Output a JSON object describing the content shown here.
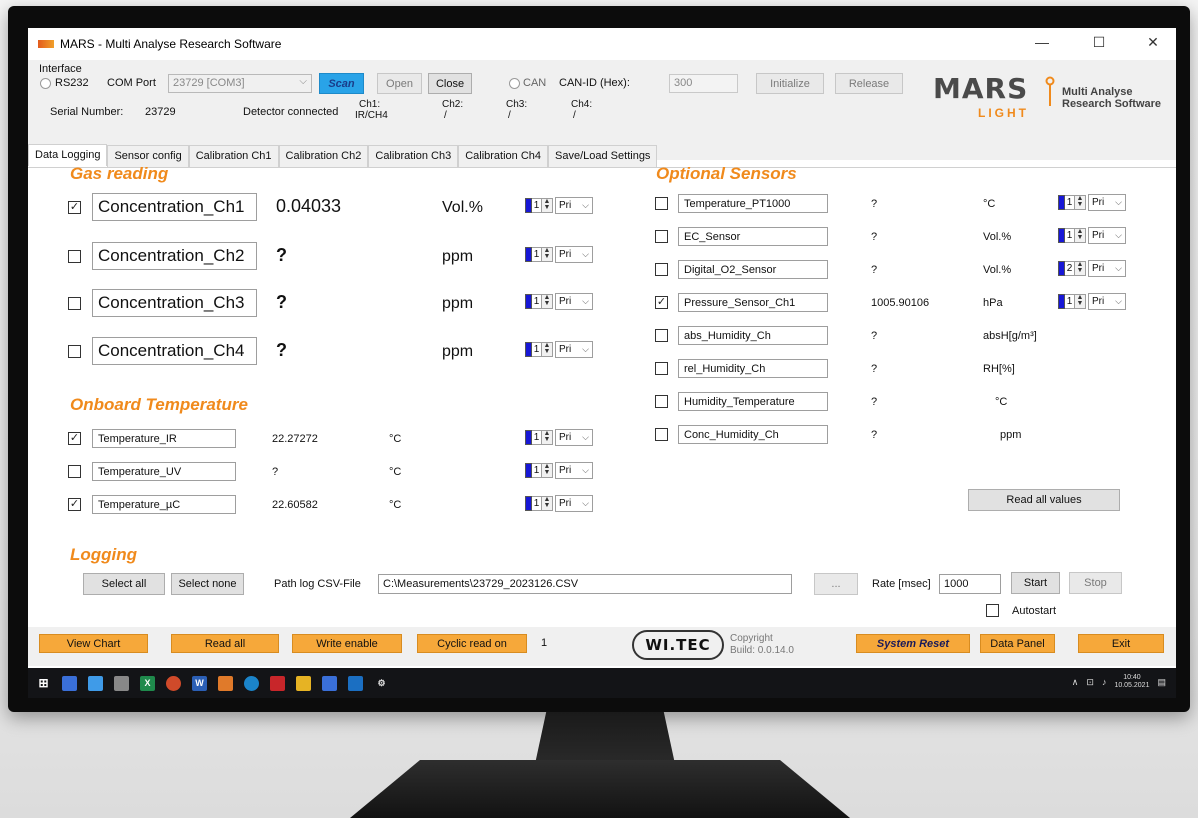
{
  "window": {
    "title": "MARS - Multi Analyse Research Software"
  },
  "interface": {
    "label": "Interface",
    "rs232_label": "RS232",
    "com_port_label": "COM Port",
    "com_port_value": "23729 [COM3]",
    "scan": "Scan",
    "open": "Open",
    "close": "Close",
    "can_label": "CAN",
    "can_id_label": "CAN-ID (Hex):",
    "can_id_value": "300",
    "initialize": "Initialize",
    "release": "Release",
    "serial_label": "Serial Number:",
    "serial_value": "23729",
    "detector_status": "Detector connected",
    "ch1_label": "Ch1:",
    "ch1_value": "IR/CH4",
    "ch2_label": "Ch2:",
    "ch2_value": "/",
    "ch3_label": "Ch3:",
    "ch3_value": "/",
    "ch4_label": "Ch4:",
    "ch4_value": "/"
  },
  "logo": {
    "mars": "MARS",
    "light": "LIGHT",
    "line1": "Multi Analyse",
    "line2": "Research Software"
  },
  "tabs": [
    "Data Logging",
    "Sensor config",
    "Calibration Ch1",
    "Calibration Ch2",
    "Calibration Ch3",
    "Calibration Ch4",
    "Save/Load Settings"
  ],
  "gas_reading": {
    "title": "Gas reading",
    "rows": [
      {
        "name": "Concentration_Ch1",
        "checked": true,
        "value": "0.04033",
        "unit": "Vol.%",
        "spin": "1",
        "pri": "Pri"
      },
      {
        "name": "Concentration_Ch2",
        "checked": false,
        "value": "?",
        "unit": "ppm",
        "spin": "1",
        "pri": "Pri"
      },
      {
        "name": "Concentration_Ch3",
        "checked": false,
        "value": "?",
        "unit": "ppm",
        "spin": "1",
        "pri": "Pri"
      },
      {
        "name": "Concentration_Ch4",
        "checked": false,
        "value": "?",
        "unit": "ppm",
        "spin": "1",
        "pri": "Pri"
      }
    ]
  },
  "onboard_temperature": {
    "title": "Onboard Temperature",
    "rows": [
      {
        "name": "Temperature_IR",
        "checked": true,
        "value": "22.27272",
        "unit": "°C",
        "spin": "1",
        "pri": "Pri"
      },
      {
        "name": "Temperature_UV",
        "checked": false,
        "value": "?",
        "unit": "°C",
        "spin": "1",
        "pri": "Pri"
      },
      {
        "name": "Temperature_µC",
        "checked": true,
        "value": "22.60582",
        "unit": "°C",
        "spin": "1",
        "pri": "Pri"
      }
    ]
  },
  "optional_sensors": {
    "title": "Optional Sensors",
    "rows": [
      {
        "name": "Temperature_PT1000",
        "checked": false,
        "value": "?",
        "unit": "°C",
        "spin": "1",
        "pri": "Pri"
      },
      {
        "name": "EC_Sensor",
        "checked": false,
        "value": "?",
        "unit": "Vol.%",
        "spin": "1",
        "pri": "Pri"
      },
      {
        "name": "Digital_O2_Sensor",
        "checked": false,
        "value": "?",
        "unit": "Vol.%",
        "spin": "2",
        "pri": "Pri"
      },
      {
        "name": "Pressure_Sensor_Ch1",
        "checked": true,
        "value": "1005.90106",
        "unit": "hPa",
        "spin": "1",
        "pri": "Pri"
      },
      {
        "name": "abs_Humidity_Ch",
        "checked": false,
        "value": "?",
        "unit": "absH[g/m³]"
      },
      {
        "name": "rel_Humidity_Ch",
        "checked": false,
        "value": "?",
        "unit": "RH[%]"
      },
      {
        "name": "Humidity_Temperature",
        "checked": false,
        "value": "?",
        "unit": "°C"
      },
      {
        "name": "Conc_Humidity_Ch",
        "checked": false,
        "value": "?",
        "unit": "ppm"
      }
    ],
    "read_all_values": "Read all values"
  },
  "logging": {
    "title": "Logging",
    "select_all": "Select all",
    "select_none": "Select none",
    "path_label": "Path log CSV-File",
    "path_value": "C:\\Measurements\\23729_2023126.CSV",
    "browse": "...",
    "rate_label": "Rate [msec]",
    "rate_value": "1000",
    "start": "Start",
    "stop": "Stop",
    "autostart": "Autostart"
  },
  "bottom": {
    "view_chart": "View Chart",
    "read_all": "Read all",
    "write_enable": "Write enable",
    "cyclic_read_on": "Cyclic read on",
    "cycle_count": "1",
    "witec": "WI.TEC",
    "copyright": "Copyright",
    "build": "Build: 0.0.14.0",
    "system_reset": "System Reset",
    "data_panel": "Data Panel",
    "exit": "Exit"
  },
  "taskbar": {
    "time": "10:40",
    "date": "10.05.2021"
  },
  "colors": {
    "accent_orange": "#f08a1c",
    "button_orange": "#f6a83a",
    "scan_blue": "#29a3e8",
    "series_swatch": "#1717d6"
  }
}
